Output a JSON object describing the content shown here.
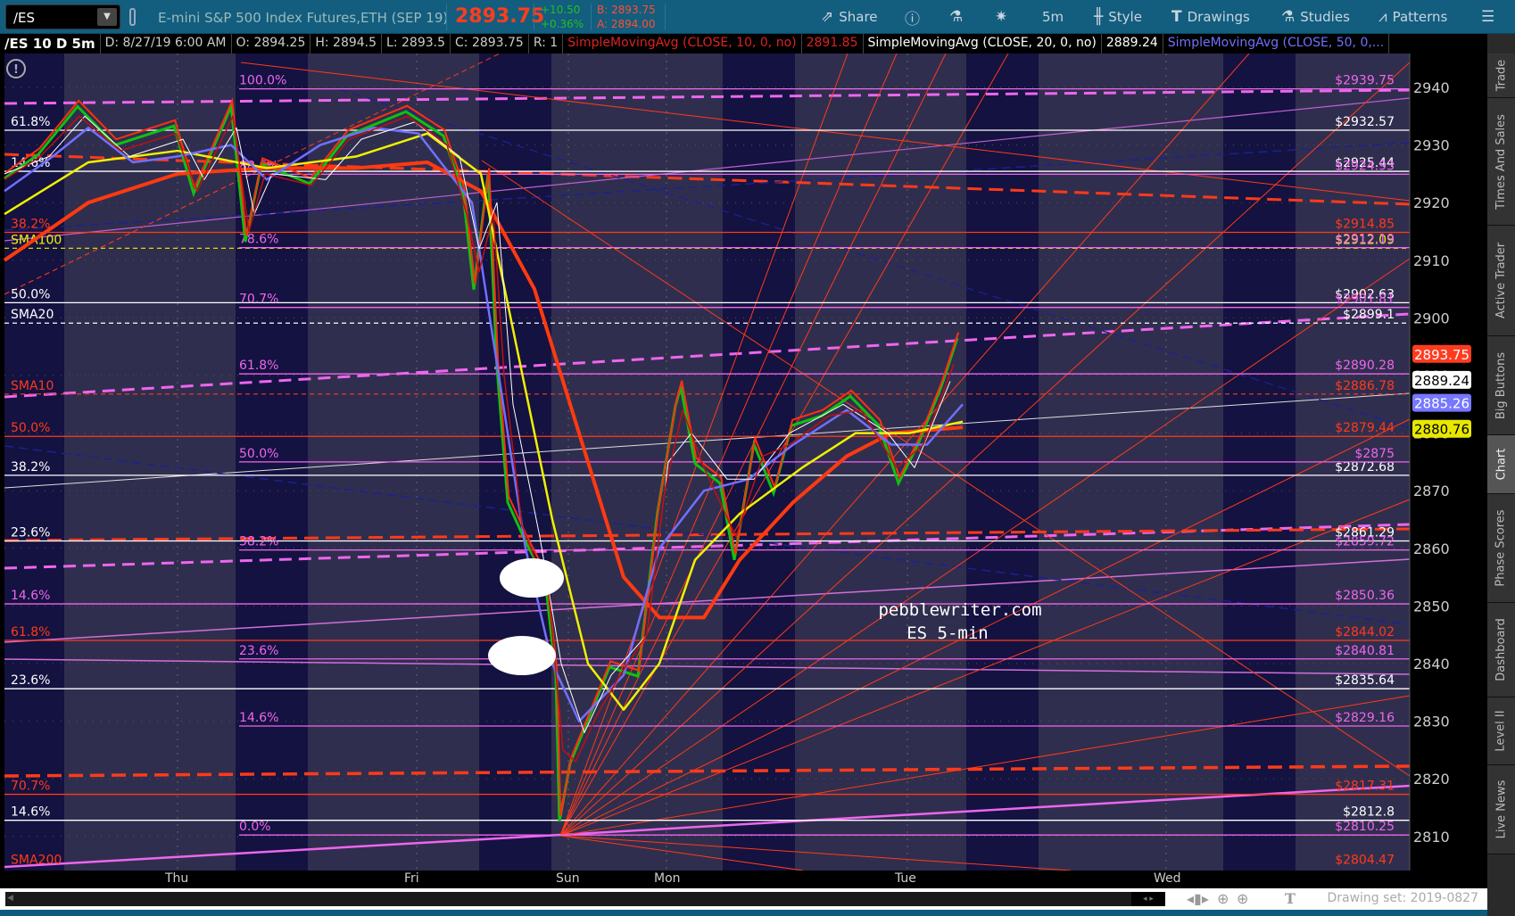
{
  "toolbar": {
    "symbol": "/ES",
    "description": "E-mini S&P 500 Index Futures,ETH (SEP 19)",
    "last": "2893.75",
    "change": "+10.50",
    "change_pct": "+0.36%",
    "bid": "B: 2893.75",
    "ask": "A: 2894.00",
    "buttons": [
      {
        "label": "Share",
        "icon": "share-icon"
      },
      {
        "label": "",
        "icon": "info-icon"
      },
      {
        "label": "",
        "icon": "flask-icon"
      },
      {
        "label": "",
        "icon": "gear-icon"
      },
      {
        "label": "5m",
        "icon": ""
      },
      {
        "label": "Style",
        "icon": "candle-icon"
      },
      {
        "label": "Drawings",
        "icon": "text-t-icon"
      },
      {
        "label": "Studies",
        "icon": "flask-icon"
      },
      {
        "label": "Patterns",
        "icon": "pattern-icon"
      }
    ]
  },
  "info": {
    "title": "/ES 10 D 5m",
    "date": "D: 8/27/19 6:00 AM",
    "open": "O: 2894.25",
    "high": "H: 2894.5",
    "low": "L: 2893.5",
    "close": "C: 2893.75",
    "range": "R: 1",
    "sma10": "SimpleMovingAvg (CLOSE, 10, 0, no)",
    "sma10_val": "2891.85",
    "sma20": "SimpleMovingAvg (CLOSE, 20, 0, no)",
    "sma20_val": "2889.24",
    "sma50": "SimpleMovingAvg (CLOSE, 50, 0,..."
  },
  "sidebar": [
    "Trade",
    "Times And Sales",
    "Active Trader",
    "Big Buttons",
    "Chart",
    "Phase Scores",
    "Dashboard",
    "Level II",
    "Live News"
  ],
  "colors": {
    "white": "#ffffff",
    "red": "#ff3a1a",
    "pink": "#ee66ee",
    "yellow": "#f0f000",
    "blue": "#7070ff",
    "navy": "#101870"
  },
  "chart_data": {
    "type": "candlestick",
    "y_ticks": [
      2810,
      2820,
      2830,
      2840,
      2850,
      2860,
      2870,
      2880,
      2890,
      2900,
      2910,
      2920,
      2930,
      2940
    ],
    "x_labels": [
      {
        "label": "Thu",
        "bar": 97
      },
      {
        "label": "Fri",
        "bar": 231
      },
      {
        "label": "Sun",
        "bar": 316
      },
      {
        "label": "Mon",
        "bar": 371
      },
      {
        "label": "Tue",
        "bar": 506
      },
      {
        "label": "Wed",
        "bar": 651
      }
    ],
    "badges": [
      {
        "value": "2893.75",
        "price": 2893.75,
        "bg": "#ff3b1f",
        "fg": "#ffffff"
      },
      {
        "value": "2889.24",
        "price": 2889.24,
        "bg": "#ffffff",
        "fg": "#000000"
      },
      {
        "value": "2885.26",
        "price": 2885.26,
        "bg": "#7777ff",
        "fg": "#ffffff"
      },
      {
        "value": "2880.76",
        "price": 2880.76,
        "bg": "#e8e800",
        "fg": "#000000"
      }
    ],
    "levels": [
      {
        "label": "61.8%",
        "price": "2932.57",
        "color": "white",
        "set": "left"
      },
      {
        "label": "14.6%",
        "price": "2925.44",
        "color": "white",
        "set": "left"
      },
      {
        "label": "50.0%",
        "price": "2902.63",
        "color": "white",
        "set": "left"
      },
      {
        "label": "38.2%",
        "price": "2872.68",
        "color": "white",
        "set": "left"
      },
      {
        "label": "23.6%",
        "price": "2861.29",
        "color": "white",
        "set": "left"
      },
      {
        "label": "23.6%",
        "price": "2835.64",
        "color": "white",
        "set": "left"
      },
      {
        "label": "14.6%",
        "price": "2812.8",
        "color": "white",
        "set": "left"
      },
      {
        "label": "38.2%",
        "price": "2914.85",
        "color": "red",
        "set": "left"
      },
      {
        "label": "50.0%",
        "price": "2879.44",
        "color": "red",
        "set": "left"
      },
      {
        "label": "61.8%",
        "price": "2844.02",
        "color": "red",
        "set": "left"
      },
      {
        "label": "70.7%",
        "price": "2817.31",
        "color": "red",
        "set": "left"
      },
      {
        "label": "SMA100",
        "price": "2912.09",
        "color": "yellow",
        "set": "left",
        "dash": true
      },
      {
        "label": "SMA20",
        "price": "2899.1",
        "color": "white",
        "set": "left",
        "dash": true
      },
      {
        "label": "SMA10",
        "price": "2886.78",
        "color": "red",
        "set": "left",
        "dash": true
      },
      {
        "label": "SMA200",
        "price": "2804.47",
        "color": "red",
        "set": "left",
        "noline": true
      },
      {
        "label": "14.6%",
        "price": "2850.36",
        "color": "pink",
        "set": "left"
      },
      {
        "label": "100.0%",
        "price": "2939.75",
        "color": "pink",
        "set": "fib"
      },
      {
        "label": "88.6%",
        "price": "2924.93",
        "color": "pink",
        "set": "fib"
      },
      {
        "label": "78.6%",
        "price": "2912.19",
        "color": "pink",
        "set": "fib"
      },
      {
        "label": "70.7%",
        "price": "2901.81",
        "color": "pink",
        "set": "fib"
      },
      {
        "label": "61.8%",
        "price": "2890.28",
        "color": "pink",
        "set": "fib"
      },
      {
        "label": "50.0%",
        "price": "2875",
        "color": "pink",
        "set": "fib"
      },
      {
        "label": "38.2%",
        "price": "2859.72",
        "color": "pink",
        "set": "fib"
      },
      {
        "label": "23.6%",
        "price": "2840.81",
        "color": "pink",
        "set": "fib"
      },
      {
        "label": "14.6%",
        "price": "2829.16",
        "color": "pink",
        "set": "fib"
      },
      {
        "label": "0.0%",
        "price": "2810.25",
        "color": "pink",
        "set": "fib"
      }
    ],
    "price": [
      [
        0,
        2924.2
      ],
      [
        19,
        2928.4
      ],
      [
        41,
        2936.7
      ],
      [
        62,
        2930
      ],
      [
        95,
        2933.3
      ],
      [
        106,
        2921.6
      ],
      [
        127,
        2936.7
      ],
      [
        135,
        2913.2
      ],
      [
        144,
        2926.7
      ],
      [
        171,
        2923.3
      ],
      [
        192,
        2931.6
      ],
      [
        225,
        2935.8
      ],
      [
        246,
        2931.6
      ],
      [
        257,
        2921.6
      ],
      [
        263,
        2904.9
      ],
      [
        271,
        2925
      ],
      [
        276,
        2891.4
      ],
      [
        282,
        2868
      ],
      [
        292,
        2861.2
      ],
      [
        303,
        2854.6
      ],
      [
        309,
        2837.8
      ],
      [
        311,
        2812.6
      ],
      [
        317,
        2822.7
      ],
      [
        328,
        2831
      ],
      [
        339,
        2839.4
      ],
      [
        355,
        2837.8
      ],
      [
        366,
        2866.3
      ],
      [
        376,
        2884.7
      ],
      [
        379,
        2888.1
      ],
      [
        387,
        2874.7
      ],
      [
        401,
        2871.3
      ],
      [
        409,
        2858
      ],
      [
        420,
        2878.1
      ],
      [
        431,
        2869.6
      ],
      [
        441,
        2881.3
      ],
      [
        458,
        2883
      ],
      [
        474,
        2886.4
      ],
      [
        490,
        2881.3
      ],
      [
        501,
        2871.3
      ],
      [
        512,
        2878.1
      ],
      [
        525,
        2888.1
      ],
      [
        534,
        2896.5
      ]
    ],
    "series": [
      {
        "name": "SMA200",
        "color": "#ff3a10",
        "width": 4,
        "points": [
          [
            0,
            2910
          ],
          [
            47,
            2920
          ],
          [
            97,
            2925
          ],
          [
            147,
            2926
          ],
          [
            197,
            2926
          ],
          [
            237,
            2927
          ],
          [
            267,
            2922
          ],
          [
            297,
            2905
          ],
          [
            322,
            2880
          ],
          [
            347,
            2855
          ],
          [
            367,
            2848
          ],
          [
            392,
            2848
          ],
          [
            412,
            2858
          ],
          [
            442,
            2868
          ],
          [
            472,
            2876
          ],
          [
            497,
            2880
          ],
          [
            537,
            2881
          ]
        ]
      },
      {
        "name": "SMA100",
        "color": "#f0f000",
        "width": 2.5,
        "points": [
          [
            0,
            2918
          ],
          [
            47,
            2927
          ],
          [
            97,
            2929
          ],
          [
            147,
            2926
          ],
          [
            197,
            2928
          ],
          [
            237,
            2932
          ],
          [
            267,
            2925
          ],
          [
            287,
            2895
          ],
          [
            307,
            2865
          ],
          [
            327,
            2840
          ],
          [
            347,
            2832
          ],
          [
            367,
            2840
          ],
          [
            387,
            2858
          ],
          [
            412,
            2866
          ],
          [
            447,
            2874
          ],
          [
            477,
            2880
          ],
          [
            507,
            2880
          ],
          [
            537,
            2882
          ]
        ]
      },
      {
        "name": "SMA50",
        "color": "#7070ff",
        "width": 2.5,
        "points": [
          [
            0,
            2922
          ],
          [
            27,
            2928
          ],
          [
            47,
            2933
          ],
          [
            72,
            2927
          ],
          [
            97,
            2928
          ],
          [
            127,
            2930
          ],
          [
            147,
            2924
          ],
          [
            177,
            2930
          ],
          [
            207,
            2933
          ],
          [
            232,
            2932
          ],
          [
            262,
            2920
          ],
          [
            277,
            2890
          ],
          [
            292,
            2860
          ],
          [
            307,
            2840
          ],
          [
            322,
            2830
          ],
          [
            347,
            2838
          ],
          [
            367,
            2860
          ],
          [
            392,
            2870
          ],
          [
            417,
            2872
          ],
          [
            442,
            2878
          ],
          [
            472,
            2884
          ],
          [
            497,
            2878
          ],
          [
            517,
            2878
          ],
          [
            537,
            2885
          ]
        ]
      },
      {
        "name": "SMA20",
        "color": "#ffffff",
        "width": 1,
        "points": [
          [
            0,
            2925
          ],
          [
            25,
            2928
          ],
          [
            45,
            2935
          ],
          [
            70,
            2928
          ],
          [
            100,
            2931
          ],
          [
            112,
            2924
          ],
          [
            130,
            2933
          ],
          [
            140,
            2918
          ],
          [
            150,
            2925
          ],
          [
            180,
            2924
          ],
          [
            200,
            2931
          ],
          [
            230,
            2934
          ],
          [
            255,
            2928
          ],
          [
            266,
            2912
          ],
          [
            276,
            2920
          ],
          [
            285,
            2885
          ],
          [
            300,
            2862
          ],
          [
            312,
            2840
          ],
          [
            325,
            2828
          ],
          [
            340,
            2838
          ],
          [
            360,
            2845
          ],
          [
            372,
            2875
          ],
          [
            385,
            2880
          ],
          [
            405,
            2872
          ],
          [
            420,
            2872
          ],
          [
            440,
            2880
          ],
          [
            470,
            2885
          ],
          [
            495,
            2880
          ],
          [
            510,
            2874
          ],
          [
            530,
            2889
          ]
        ]
      },
      {
        "name": "SMA10",
        "color": "#c01010",
        "width": 1.5,
        "points": [
          [
            0,
            2924
          ],
          [
            20,
            2928
          ],
          [
            42,
            2935
          ],
          [
            65,
            2929
          ],
          [
            96,
            2932
          ],
          [
            108,
            2922
          ],
          [
            128,
            2935
          ],
          [
            137,
            2915
          ],
          [
            146,
            2925
          ],
          [
            172,
            2923
          ],
          [
            193,
            2931
          ],
          [
            226,
            2935
          ],
          [
            248,
            2930
          ],
          [
            259,
            2918
          ],
          [
            266,
            2908
          ],
          [
            274,
            2918
          ],
          [
            280,
            2890
          ],
          [
            290,
            2864
          ],
          [
            305,
            2852
          ],
          [
            313,
            2825
          ],
          [
            320,
            2823
          ],
          [
            332,
            2831
          ],
          [
            345,
            2838
          ],
          [
            360,
            2845
          ],
          [
            370,
            2870
          ],
          [
            380,
            2884
          ],
          [
            392,
            2874
          ],
          [
            410,
            2862
          ],
          [
            425,
            2876
          ],
          [
            440,
            2878
          ],
          [
            462,
            2883
          ],
          [
            480,
            2884
          ],
          [
            500,
            2874
          ],
          [
            515,
            2878
          ],
          [
            532,
            2892
          ]
        ]
      }
    ]
  },
  "watermark": {
    "line1": "pebblewriter.com",
    "line2": "ES 5-min"
  },
  "footer": {
    "drawing_set": "Drawing set: 2019-0827"
  }
}
